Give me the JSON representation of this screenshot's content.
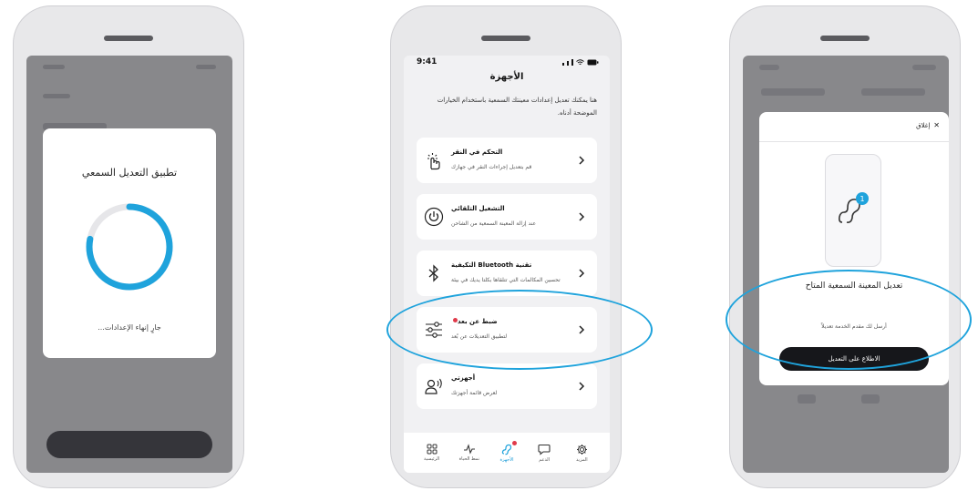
{
  "colors": {
    "accent": "#1fa3dc",
    "notification": "#e03a4a",
    "dark_button": "#16171b"
  },
  "phone1": {
    "modal_title": "تطبيق التعديل السمعي",
    "status": "جارٍ إنهاء الإعدادات...",
    "progress_fraction": 0.78
  },
  "phone2": {
    "time": "9:41",
    "page_title": "الأجهزة",
    "description": "هنا يمكنك تعديل إعدادات معينتك السمعية باستخدام الخيارات الموضحة أدناه.",
    "cards": [
      {
        "icon": "tap-hand-icon",
        "title": "التحكم في النقر",
        "desc": "قم بتعديل إجراءات النقر في جهازك",
        "dot": false
      },
      {
        "icon": "power-icon",
        "title": "التشغيل التلقائي",
        "desc": "عند إزالة المعينة السمعية من الشاحن",
        "dot": false
      },
      {
        "icon": "bluetooth-icon",
        "title": "تقنية Bluetooth التكيفية",
        "desc": "تحسين المكالمات التي تتلقاها بكلتا يديك في بيئة",
        "dot": false
      },
      {
        "icon": "sliders-icon",
        "title": "ضبط عن بعد",
        "desc": "لتطبيق التعديلات عن بُعد",
        "dot": true
      },
      {
        "icon": "user-sound-icon",
        "title": "أجهزتي",
        "desc": "لعرض قائمة أجهزتك",
        "dot": false
      }
    ],
    "tabs": [
      {
        "icon": "grid-icon",
        "label": "الرئيسية",
        "active": false,
        "dot": false
      },
      {
        "icon": "pulse-icon",
        "label": "نمط الحياة",
        "active": false,
        "dot": false
      },
      {
        "icon": "hearing-aid-icon",
        "label": "الأجهزة",
        "active": true,
        "dot": true
      },
      {
        "icon": "chat-bubble-icon",
        "label": "الدعم",
        "active": false,
        "dot": false
      },
      {
        "icon": "gear-icon",
        "label": "المزيد",
        "active": false,
        "dot": false
      }
    ]
  },
  "phone3": {
    "close_label": "إغلاق",
    "badge": "1",
    "modal_title": "تعديل المعينة السمعية المتاح",
    "modal_desc": "أرسل لك مقدم الخدمة تعديلاً",
    "cta": "الاطلاع على التعديل"
  }
}
